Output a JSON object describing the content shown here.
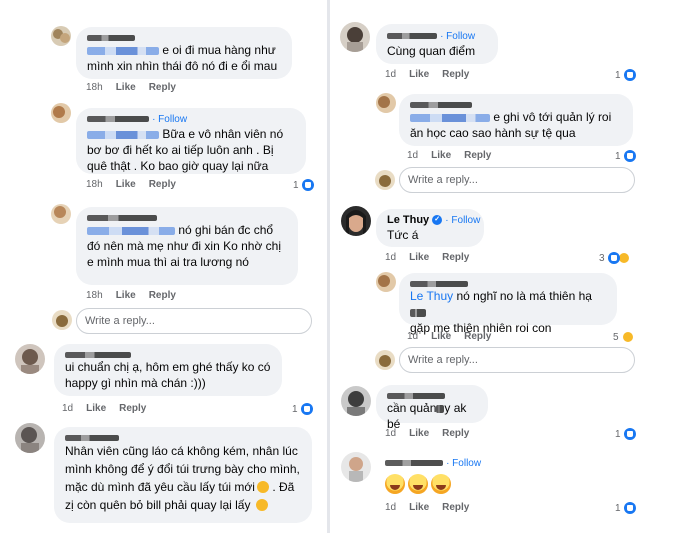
{
  "left": {
    "comments": [
      {
        "text": "e oi đi mua hàng như mình xin nhìn thái đô nó đi e ổi mau",
        "time": "18h",
        "like": "Like",
        "reply": "Reply"
      },
      {
        "follow": "· Follow",
        "text": "Bữa e vô nhân viên nó bơ bơ đi hết ko ai tiếp luôn anh . Bị quê thật . Ko bao giờ quay lại nữa",
        "time": "18h",
        "like": "Like",
        "reply": "Reply",
        "reactions": "1"
      },
      {
        "text": "nó ghi bán đc chổ đó nên mà mẹ như đi xin Ko nhờ chị e mình mua thì ai tra lương nó",
        "time": "18h",
        "like": "Like",
        "reply": "Reply"
      },
      {
        "text": "ui chuẩn chị ạ, hôm em ghé thấy ko có happy gì nhìn mà chán :)))",
        "time": "1d",
        "like": "Like",
        "reply": "Reply",
        "reactions": "1"
      },
      {
        "text": "Nhân viên cũng láo cá không kém, nhân lúc mình không để ý đổi túi trưng bày cho mình, mặc dù mình đã yêu cầu lấy túi mới",
        "text2": ". Đã zị còn quên bỏ bill phải quay lại lấy"
      }
    ],
    "reply_placeholder": "Write a reply..."
  },
  "right": {
    "comments": [
      {
        "follow": "· Follow",
        "text": "Cùng quan điểm",
        "time": "1d",
        "like": "Like",
        "reply": "Reply",
        "reactions": "1"
      },
      {
        "text": "e ghi vô tới quản lý roi ăn học cao sao hành sự tệ qua",
        "time": "1d",
        "like": "Like",
        "reply": "Reply",
        "reactions": "1"
      },
      {
        "name": "Le Thuy",
        "follow": "· Follow",
        "text": "Tức á",
        "time": "1d",
        "like": "Like",
        "reply": "Reply",
        "reactions": "3"
      },
      {
        "mention": "Le Thuy",
        "text": "nó nghĩ no là má thiên hạ",
        "text2": "gặp mẹ thiên nhiên roi con",
        "time": "1d",
        "like": "Like",
        "reply": "Reply",
        "reactions": "5"
      },
      {
        "text": "cần quản",
        "text2": "y ak bé",
        "time": "1d",
        "like": "Like",
        "reply": "Reply",
        "reactions": "1"
      },
      {
        "follow": "· Follow",
        "time": "1d",
        "like": "Like",
        "reply": "Reply",
        "reactions": "1"
      }
    ],
    "reply_placeholder": "Write a reply..."
  },
  "colors": {
    "link": "#1877f2",
    "bubble": "#f0f2f5",
    "meta": "#65676b"
  }
}
